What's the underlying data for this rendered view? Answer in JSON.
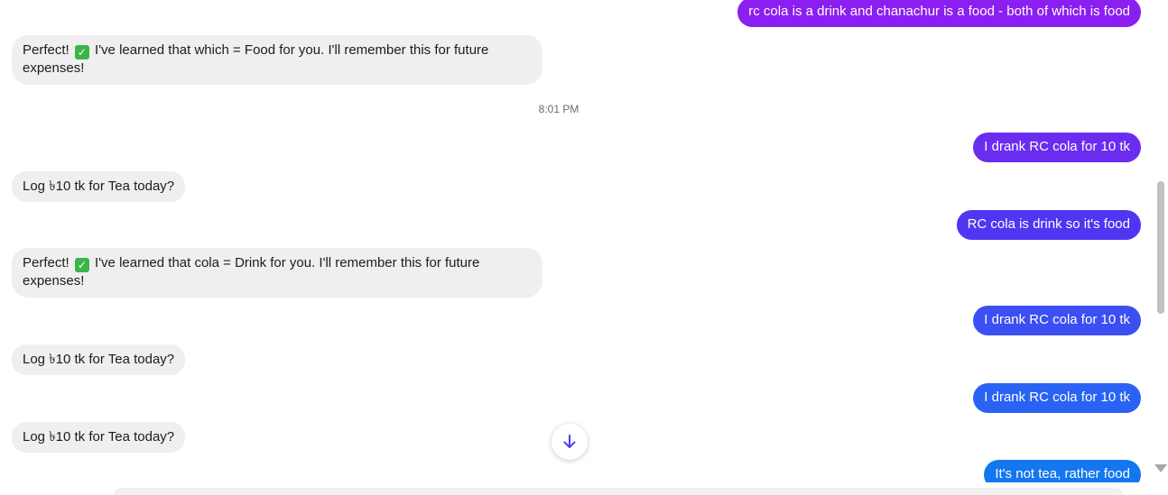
{
  "conversation": {
    "messages": [
      {
        "role": "user",
        "text": "rc cola is a drink and chanachur is a food - both of which is food",
        "color": "#8b1ef0"
      },
      {
        "role": "bot",
        "before_check": "Perfect! ",
        "after_check": " I've learned that which = Food for you. I'll remember this for future expenses!"
      },
      {
        "role": "timestamp",
        "text": "8:01 PM"
      },
      {
        "role": "user",
        "text": "I drank RC cola for 10 tk",
        "color": "#6a2df0"
      },
      {
        "role": "bot",
        "text": "Log ৳10 tk for Tea today?"
      },
      {
        "role": "user",
        "text": "RC cola is drink so it's food",
        "color": "#5036f2"
      },
      {
        "role": "bot",
        "before_check": "Perfect! ",
        "after_check": " I've learned that cola = Drink for you. I'll remember this for future expenses!"
      },
      {
        "role": "user",
        "text": "I drank RC cola for 10 tk",
        "color": "#3b4ff3"
      },
      {
        "role": "bot",
        "text": "Log ৳10 tk for Tea today?"
      },
      {
        "role": "user",
        "text": "I drank RC cola for 10 tk",
        "color": "#2a63f4"
      },
      {
        "role": "bot",
        "text": "Log ৳10 tk for Tea today?"
      },
      {
        "role": "user",
        "text": "It's not tea, rather food",
        "color": "#1477f0"
      }
    ]
  },
  "controls": {
    "scroll_down_icon": "arrow-down-icon",
    "scroll_down_color": "#4a3ff0"
  }
}
